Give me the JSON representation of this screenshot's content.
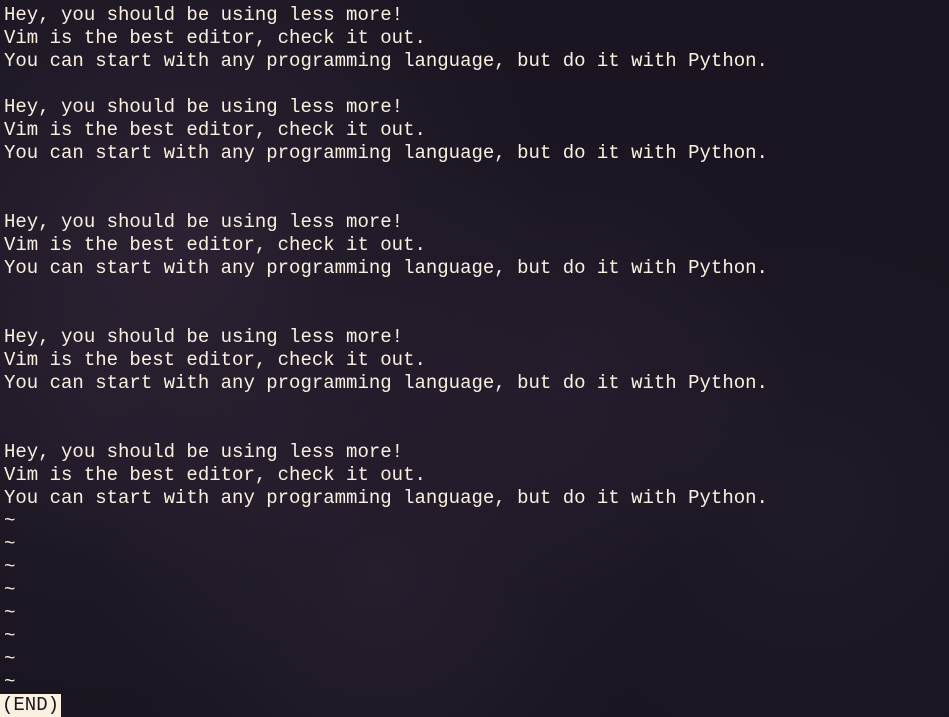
{
  "blocks": [
    {
      "lines": [
        "Hey, you should be using less more!",
        "Vim is the best editor, check it out.",
        "You can start with any programming language, but do it with Python."
      ],
      "trailingBlanks": 1
    },
    {
      "lines": [
        "Hey, you should be using less more!",
        "Vim is the best editor, check it out.",
        "You can start with any programming language, but do it with Python."
      ],
      "trailingBlanks": 2
    },
    {
      "lines": [
        "Hey, you should be using less more!",
        "Vim is the best editor, check it out.",
        "You can start with any programming language, but do it with Python."
      ],
      "trailingBlanks": 2
    },
    {
      "lines": [
        "Hey, you should be using less more!",
        "Vim is the best editor, check it out.",
        "You can start with any programming language, but do it with Python."
      ],
      "trailingBlanks": 2
    },
    {
      "lines": [
        "Hey, you should be using less more!",
        "Vim is the best editor, check it out.",
        "You can start with any programming language, but do it with Python."
      ],
      "trailingBlanks": 0
    }
  ],
  "tilde": "~",
  "tildeCount": 8,
  "status": "(END)"
}
